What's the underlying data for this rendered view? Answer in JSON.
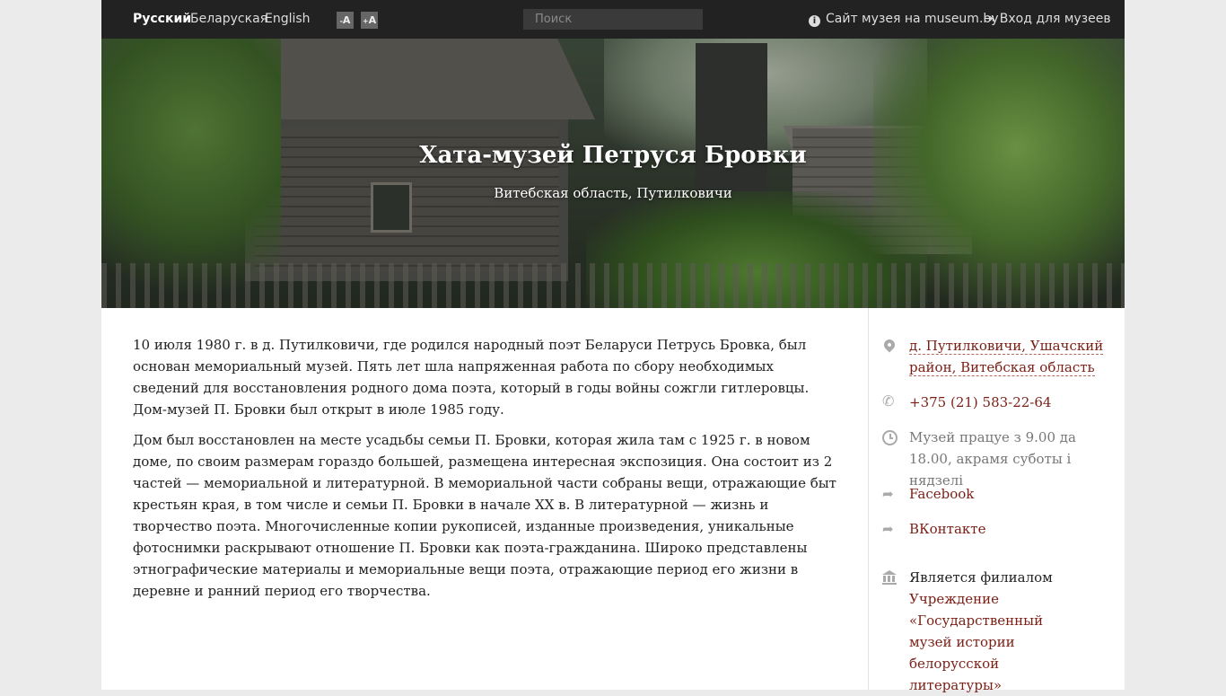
{
  "topbar": {
    "languages": [
      "Русский",
      "Беларуская",
      "English"
    ],
    "active_language": "Русский",
    "font_smaller": "A",
    "font_larger": "A",
    "search_placeholder": "Поиск",
    "museum_site_link": "Сайт музея на museum.by",
    "login_link": "Вход для музеев"
  },
  "hero": {
    "title": "Хата-музей Петруся Бровки",
    "subtitle": "Витебская область, Путилковичи"
  },
  "main": {
    "paragraphs": [
      "10 июля 1980 г. в д. Путилковичи, где родился народный поэт Беларуси Петрусь Бровка, был основан мемориальный музей. Пять лет шла напряженная работа по сбору необходимых сведений для восстановления родного дома поэта, который в годы войны сожгли гитлеровцы. Дом-музей П. Бровки был открыт в июле 1985 году.",
      "Дом был восстановлен на месте усадьбы семьи П. Бровки, которая жила там с 1925 г. в новом доме, по своим размерам гораздо большей, размещена интересная экспозиция. Она состоит из 2 частей — мемориальной и литературной. В мемориальной части собраны вещи, отражающие быт крестьян края, в том числе и семьи П. Бровки в начале XX в. В литературной — жизнь и творчество поэта. Многочисленные копии рукописей, изданные произведения, уникальные фотоснимки раскрывают отношение П. Бровки как поэта-гражданина. Широко представлены этнографические материалы и мемориальные вещи поэта, отражающие период его жизни в деревне и ранний период его творчества."
    ]
  },
  "sidebar": {
    "address_line1": "д. Путилковичи, Ушачский",
    "address_line2": "район, Витебская область",
    "phone": "+375 (21) 583-22-64",
    "hours": "Музей працуе з 9.00 да 18.00, акрамя суботы і нядзелі",
    "facebook": "Facebook",
    "vkontakte": "ВКонтакте",
    "branch_heading": "Является филиалом",
    "branch_parent": "Учреждение «Государственный музей истории белорусской литературы»"
  },
  "colors": {
    "topbar_bg": "#222222",
    "link": "#7a1f16",
    "icon": "#aaaaaa"
  },
  "icons": [
    "info-icon",
    "login-icon",
    "map-pin-icon",
    "phone-icon",
    "clock-icon",
    "share-icon",
    "institution-icon"
  ]
}
